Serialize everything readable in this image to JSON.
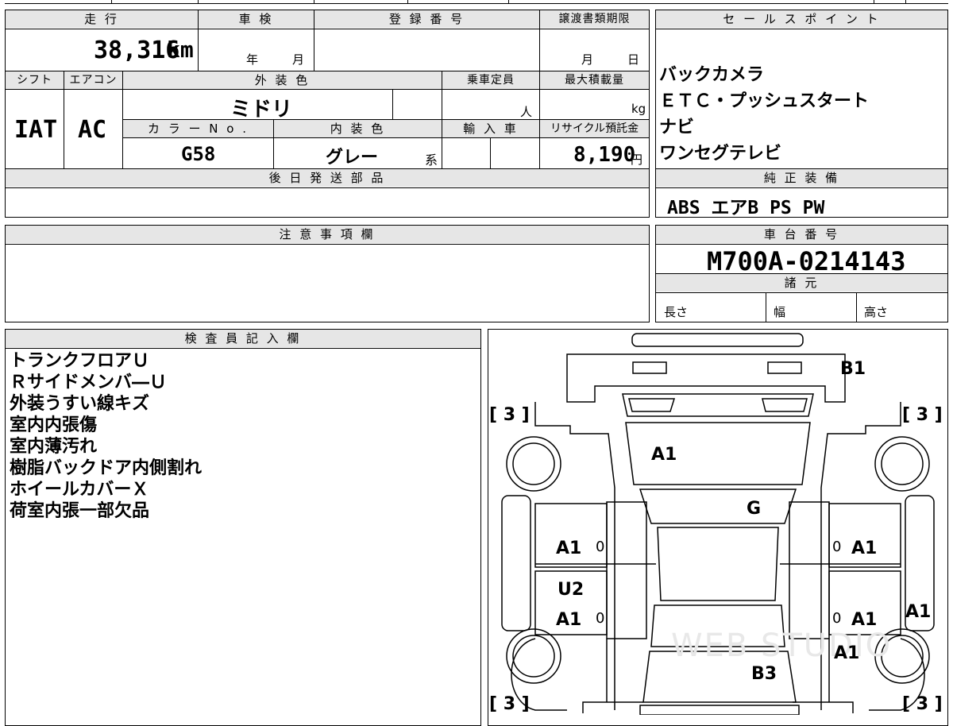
{
  "headers": {
    "mileage": "走 行",
    "inspection": "車 検",
    "registration": "登 録 番 号",
    "transfer_deadline": "譲渡書類期限",
    "sales_points": "セ ー ル ス ポ イ ン ト",
    "shift": "シフト",
    "aircon": "エアコン",
    "exterior_color": "外 装 色",
    "capacity": "乗車定員",
    "max_load": "最大積載量",
    "color_no": "カ ラ ー N o .",
    "interior_color": "内 装 色",
    "import": "輸 入 車",
    "recycle": "リサイクル預託金",
    "later_parts": "後 日 発 送 部 品",
    "genuine_equipment": "純 正 装 備",
    "notes": "注 意 事 項 欄",
    "chassis_no": "車 台 番 号",
    "specs": "諸 元",
    "inspector": "検 査 員 記 入 欄"
  },
  "values": {
    "mileage": "38,316",
    "mileage_unit": "km",
    "inspection_year": "年",
    "inspection_month": "月",
    "deadline_month": "月",
    "deadline_day": "日",
    "shift": "IAT",
    "aircon": "AC",
    "exterior_color": "ミドリ",
    "capacity_unit": "人",
    "load_unit": "kg",
    "color_no": "G58",
    "interior_color": "グレー",
    "interior_suffix": "系",
    "recycle": "8,190",
    "recycle_unit": "円",
    "genuine_equipment": "ABS エアB PS PW",
    "chassis_no": "M700A-0214143",
    "length": "長さ",
    "width": "幅",
    "height": "高さ"
  },
  "sales_points": [
    "バックカメラ",
    "ＥＴＣ・プッシュスタート",
    "ナビ",
    "ワンセグテレビ"
  ],
  "inspector_notes": [
    "トランクフロアＵ",
    "Ｒサイドメンバ―Ｕ",
    "外装うすい線キズ",
    "室内内張傷",
    "室内薄汚れ",
    "樹脂バックドア内側割れ",
    "ホイールカバーＸ",
    "荷室内張一部欠品"
  ],
  "diagram": {
    "b1": "B1",
    "a1_rear_glass": "A1",
    "g_roof": "G",
    "a1_left_rear_door": "A1",
    "u2_left": "U2",
    "a1_left_front_door": "A1",
    "a1_right_rear_door": "A1",
    "a1_right_front_door": "A1",
    "a1_right_fender": "A1",
    "a1_front_right": "A1",
    "b3_hood": "B3",
    "zero": "0",
    "tire_tl": "[ 3 ]",
    "tire_tr": "[ 3 ]",
    "tire_bl": "[ 3 ]",
    "tire_br": "[ 3 ]",
    "watermark": "WEB STUDIO"
  }
}
